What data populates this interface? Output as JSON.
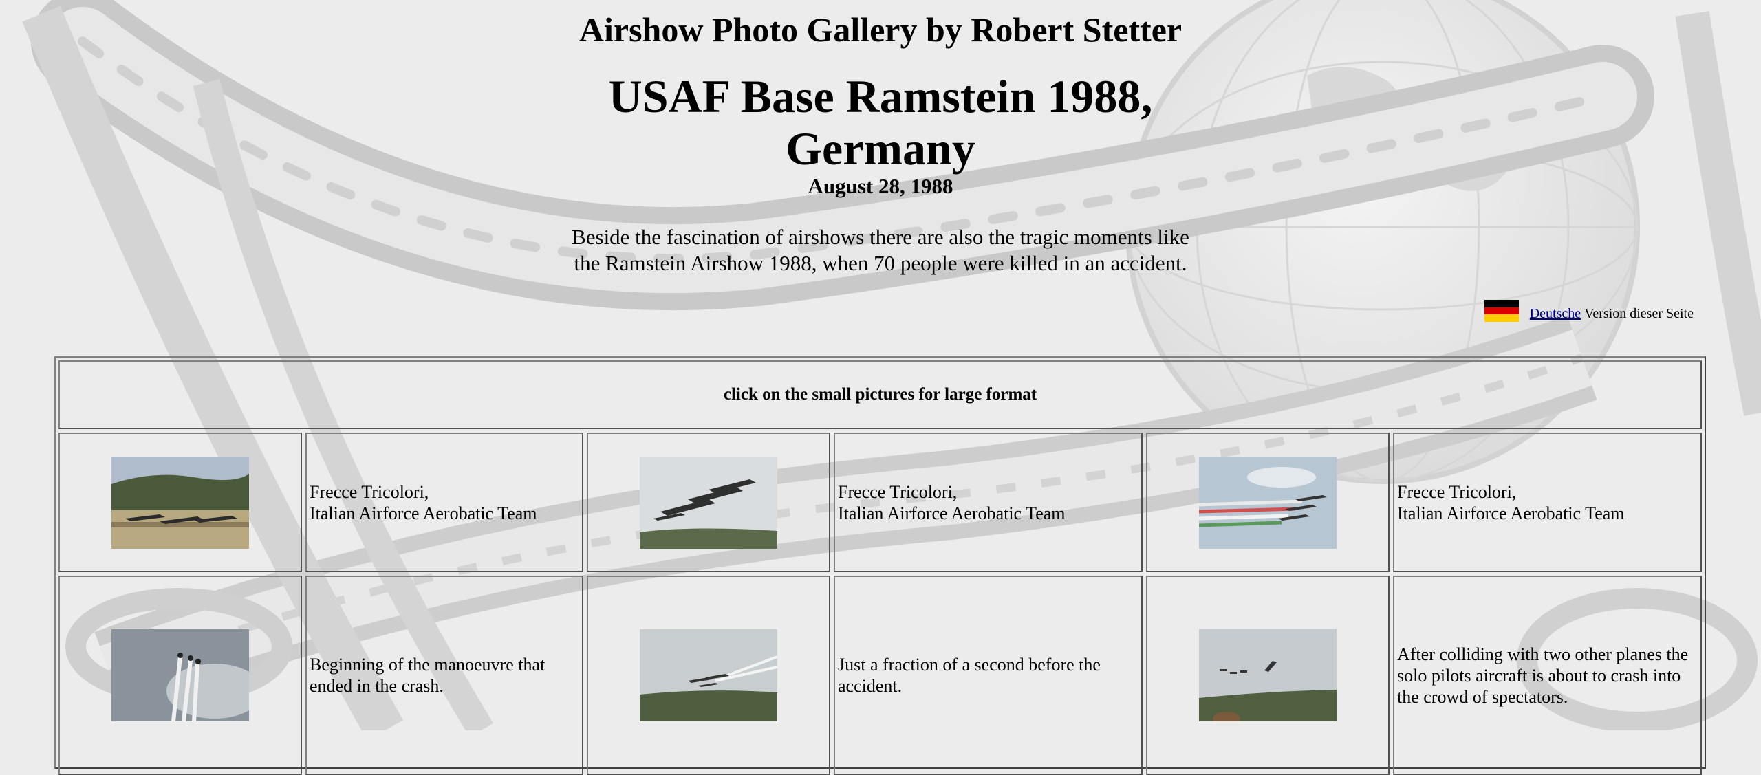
{
  "site_title": "Airshow Photo Gallery by Robert Stetter",
  "page_title_line1": "USAF Base Ramstein 1988,",
  "page_title_line2": "Germany",
  "date": "August 28, 1988",
  "intro_line1": "Beside the fascination of airshows there are also the tragic moments like",
  "intro_line2": "the Ramstein Airshow 1988, when 70 people were killed in an accident.",
  "language_link": {
    "link": "Deutsche",
    "rest": "Version dieser Seite"
  },
  "gallery_header": "click on the small pictures for large format",
  "colors": {
    "flag_black": "#000000",
    "flag_red": "#dd0000",
    "flag_gold": "#ffce00",
    "link": "#00008b"
  },
  "rows": [
    [
      {
        "thumb": "frecce-tricolori-jets-on-runway",
        "caption1": "Frecce Tricolori,",
        "caption2": "Italian Airforce Aerobatic Team",
        "caption3": ""
      },
      {
        "thumb": "frecce-tricolori-formation-close",
        "caption1": "Frecce Tricolori,",
        "caption2": "Italian Airforce Aerobatic Team",
        "caption3": ""
      },
      {
        "thumb": "frecce-tricolori-smoke-trails",
        "caption1": "Frecce Tricolori,",
        "caption2": "Italian Airforce Aerobatic Team",
        "caption3": ""
      }
    ],
    [
      {
        "thumb": "manoeuvre-beginning-smoke",
        "caption1": "Beginning of the manoeuvre that",
        "caption2": "ended in the crash.",
        "caption3": ""
      },
      {
        "thumb": "moment-before-accident",
        "caption1": "Just a fraction of a second before the",
        "caption2": "accident.",
        "caption3": ""
      },
      {
        "thumb": "solo-aircraft-before-crash",
        "caption1": "After colliding with two other planes the",
        "caption2": "solo pilots aircraft is about to crash into",
        "caption3": "the crowd of spectators."
      }
    ]
  ]
}
